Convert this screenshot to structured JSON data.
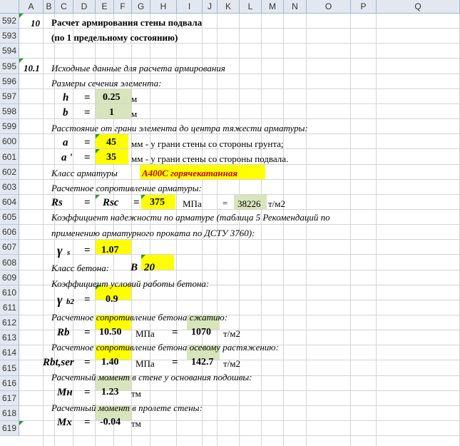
{
  "columns": [
    "A",
    "B",
    "C",
    "D",
    "E",
    "F",
    "G",
    "H",
    "I",
    "J",
    "K",
    "L",
    "M",
    "N",
    "O",
    "P",
    "Q"
  ],
  "rows": [
    "592",
    "593",
    "594",
    "595",
    "596",
    "597",
    "598",
    "599",
    "600",
    "601",
    "602",
    "603",
    "604",
    "605",
    "606",
    "607",
    "608",
    "609",
    "610",
    "611",
    "612",
    "613",
    "614",
    "615",
    "616",
    "617",
    "618",
    "619"
  ],
  "section10": {
    "number": "10",
    "title_line1": "Расчет армирования стены подвала",
    "title_line2": "(по 1 предельному состоянию)"
  },
  "section101": {
    "number": "10.1",
    "title": "Исходные данные для расчета армирования"
  },
  "dimensions": {
    "label": "Размеры сечения элемента:",
    "h": {
      "symbol": "h",
      "eq": "=",
      "value": "0.25",
      "unit": "м"
    },
    "b": {
      "symbol": "b",
      "eq": "=",
      "value": "1",
      "unit": "м"
    }
  },
  "distance": {
    "label": "Расстояние от грани элемента до центра тяжести арматуры:",
    "a": {
      "symbol": "a",
      "eq": "=",
      "value": "45",
      "note": "мм - у грани стены со стороны грунта;"
    },
    "a_prime": {
      "symbol": "a '",
      "eq": "=",
      "value": "35",
      "note": "мм - у грани стены со стороны подвала."
    }
  },
  "rebar_class": {
    "label": "Класс арматуры",
    "value": "А400С горячекатанная"
  },
  "rebar_resistance": {
    "label": "Расчетное сопротивление арматуры:",
    "rs": "Rs",
    "eq1": "=",
    "rsc": "Rsc",
    "eq2": "=",
    "value": "375",
    "unit": "МПа",
    "eq3": "=",
    "value2": "38226",
    "unit2": "т/м2"
  },
  "reliability": {
    "line1": "Коэффициент надежности по арматуре (таблица 5 Рекомендаций по",
    "line2": "применению арматурного проката по ДСТУ 3760):",
    "symbol": "γ",
    "subscript": "s",
    "eq": "=",
    "value": "1.07"
  },
  "concrete_class": {
    "label": "Класс бетона:",
    "letter": "B",
    "value": "20"
  },
  "work_conditions": {
    "label": "Коэффициент условий работы бетона:",
    "symbol": "γ",
    "subscript": "b2",
    "eq": "=",
    "value": "0.9"
  },
  "compression": {
    "label": "Расчетное сопротивление бетона сжатию:",
    "symbol": "Rb",
    "eq": "=",
    "value": "10.50",
    "unit": "МПа",
    "eq2": "=",
    "value2": "1070",
    "unit2": "т/м2"
  },
  "tension": {
    "label": "Расчетное сопротивление бетона осевому растяжению:",
    "symbol": "Rbt,ser",
    "eq": "=",
    "value": "1.40",
    "unit": "МПа",
    "eq2": "=",
    "value2": "142.7",
    "unit2": "т/м2"
  },
  "moment_base": {
    "label": "Расчетный момент в стене у основания подошвы:",
    "symbol": "Мн",
    "eq": "=",
    "value": "1.23",
    "unit": "тм"
  },
  "moment_span": {
    "label": "Расчетный момент в пролете стены:",
    "symbol": "Мх",
    "eq": "=",
    "value": "-0.04",
    "unit": "тм"
  },
  "colors": {
    "yellow": "#ffff00",
    "green": "#d8e4bc",
    "header": "#e3e8f0",
    "text_red": "#c00000"
  }
}
